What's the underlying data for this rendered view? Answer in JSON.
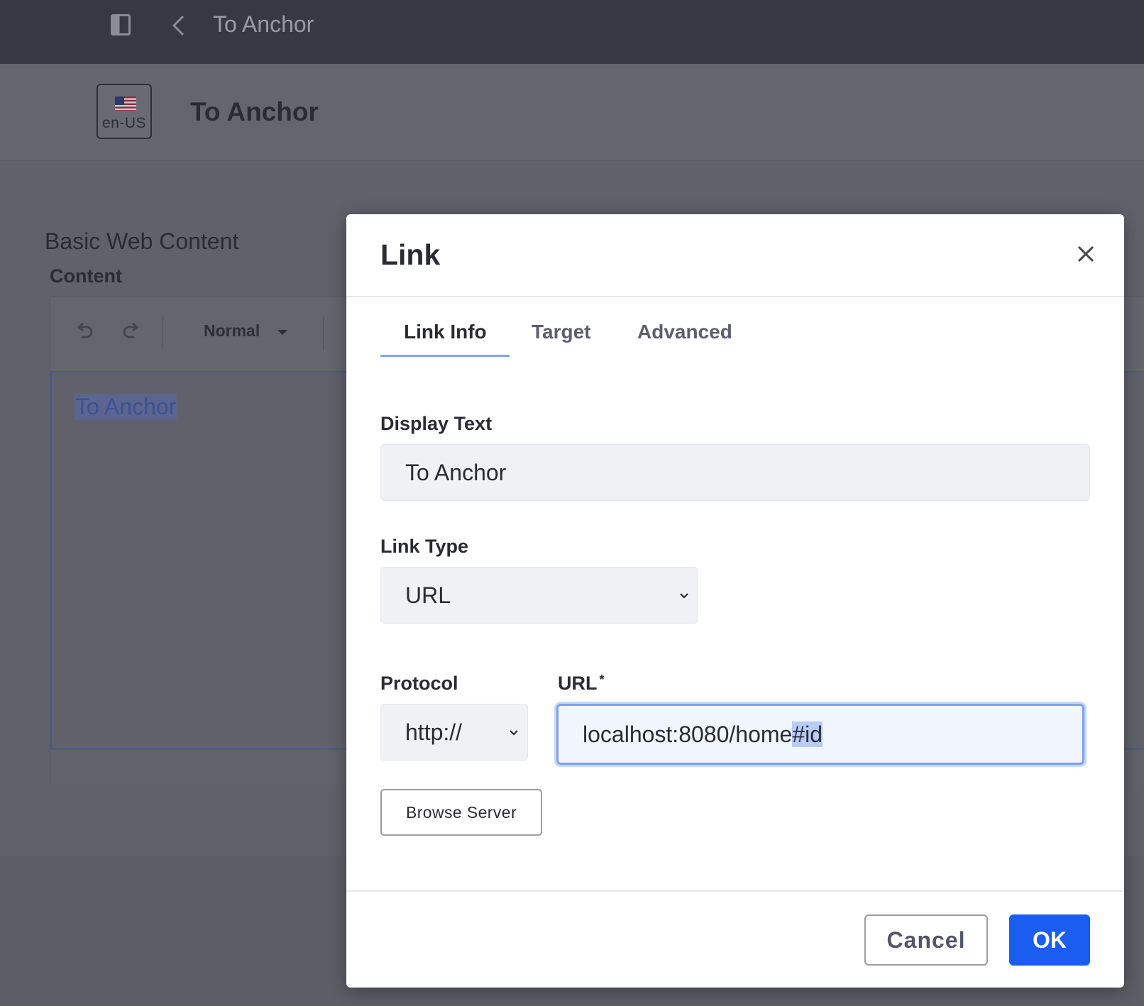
{
  "topbar": {
    "title": "To Anchor"
  },
  "header": {
    "locale": "en-US",
    "title": "To Anchor"
  },
  "page": {
    "section_title": "Basic Web Content",
    "content_label": "Content"
  },
  "editor": {
    "format_label": "Normal",
    "text": "To Anchor"
  },
  "modal": {
    "title": "Link",
    "tabs": [
      {
        "label": "Link Info",
        "active": true
      },
      {
        "label": "Target",
        "active": false
      },
      {
        "label": "Advanced",
        "active": false
      }
    ],
    "display_text": {
      "label": "Display Text",
      "value": "To Anchor"
    },
    "link_type": {
      "label": "Link Type",
      "value": "URL"
    },
    "protocol": {
      "label": "Protocol",
      "value": "http://"
    },
    "url": {
      "label": "URL",
      "required_mark": "*",
      "value_plain": "localhost:8080/home",
      "value_selected": "#id"
    },
    "browse_label": "Browse Server",
    "cancel_label": "Cancel",
    "ok_label": "OK"
  },
  "colors": {
    "primary": "#1b5cf1",
    "focus_ring": "#7da1ef",
    "tab_underline": "#80a4f4",
    "topbar": "#383845"
  },
  "icons": [
    "panel-toggle-icon",
    "back-chevron-icon",
    "flag-icon",
    "undo-icon",
    "redo-icon",
    "close-icon",
    "chevron-down-icon"
  ]
}
